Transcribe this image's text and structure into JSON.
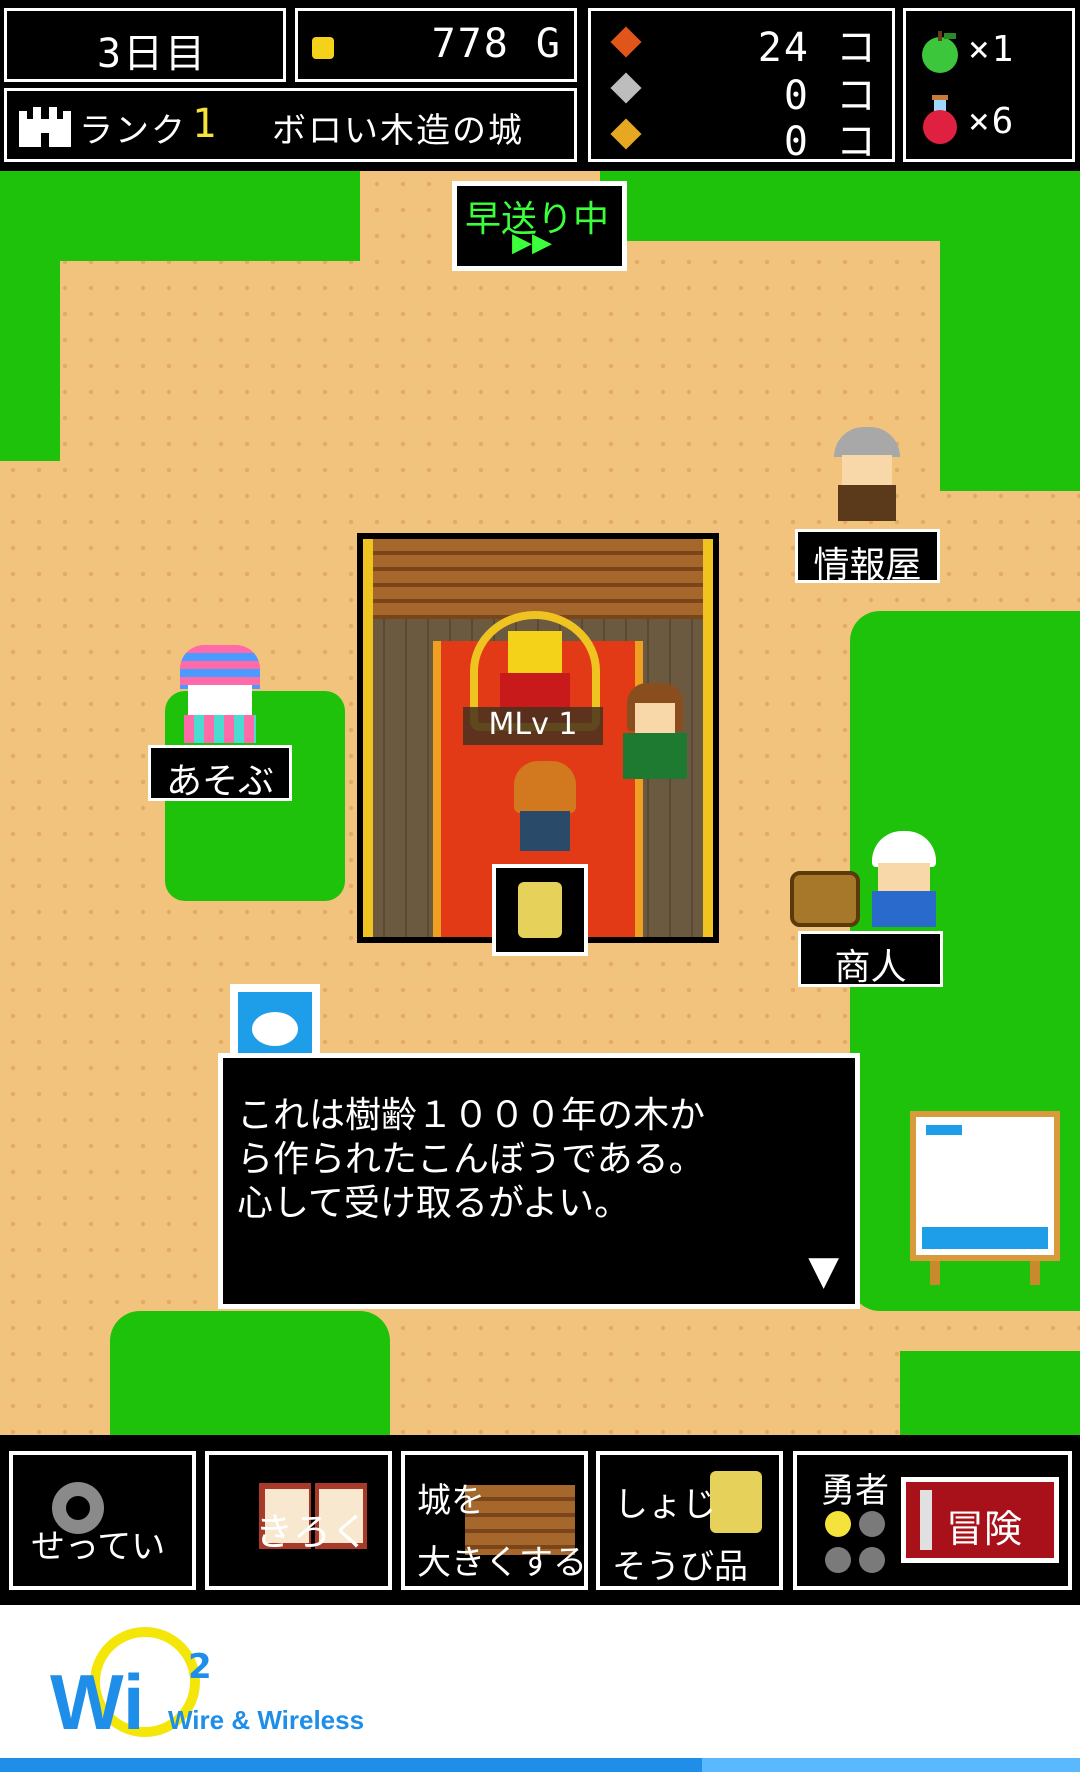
{
  "hud": {
    "day": "3日目",
    "gold": "778 G",
    "rank_label": "ランク",
    "rank_value": "1",
    "castle_name": "ボロい木造の城",
    "gems": [
      {
        "icon": "red-gem-icon",
        "count": "24 コ",
        "color": "#e0561a"
      },
      {
        "icon": "silver-gem-icon",
        "count": "0 コ",
        "color": "#bdbdbd"
      },
      {
        "icon": "gold-gem-icon",
        "count": "0 コ",
        "color": "#e6a820"
      }
    ],
    "apple_count": "×1",
    "potion_count": "×6"
  },
  "field": {
    "fast_forward_label": "早送り中",
    "fast_forward_arrows": "▶▶",
    "king_level": "MLv 1",
    "npc_labels": {
      "info": "情報屋",
      "play": "あそぶ",
      "merchant": "商人"
    },
    "dialog_text_lines": [
      "これは樹齢１０００年の木か",
      "ら作られたこんぼうである。",
      "心して受け取るがよい。"
    ],
    "dialog_next": "▼"
  },
  "commands": {
    "settings": "せってい",
    "records": "きろく",
    "expand_line1": "城を",
    "expand_line2": "大きくする",
    "items_line1": "しょじ",
    "items_line2": "そうび品",
    "hero_label": "勇者",
    "adventure": "冒険"
  },
  "ad": {
    "brand_mark": "Wi",
    "brand_sup": "2",
    "brand_text": "Wire & Wireless"
  },
  "colors": {
    "grass": "#1ec20a",
    "sand": "#f2c37c",
    "carpet": "#e23a16",
    "gold_trim": "#f0c420",
    "ff_text": "#3cff3c",
    "adventure_bg": "#a8101a"
  }
}
